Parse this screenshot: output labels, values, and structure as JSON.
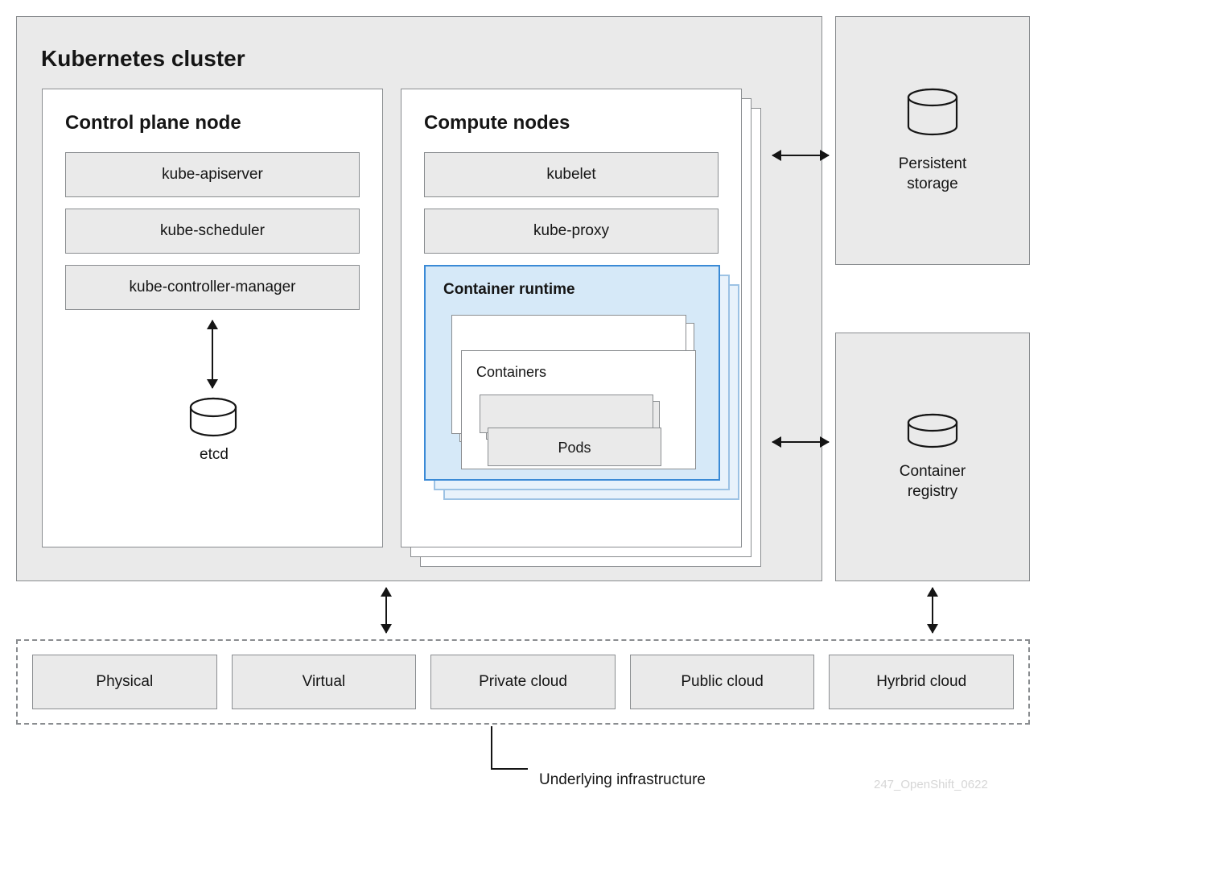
{
  "cluster": {
    "title": "Kubernetes cluster",
    "control_plane": {
      "title": "Control plane node",
      "components": [
        "kube-apiserver",
        "kube-scheduler",
        "kube-controller-manager"
      ],
      "etcd_label": "etcd"
    },
    "compute": {
      "title": "Compute nodes",
      "components": [
        "kubelet",
        "kube-proxy"
      ],
      "runtime": {
        "title": "Container runtime",
        "containers_label": "Containers",
        "pods_label": "Pods"
      }
    }
  },
  "storage": {
    "label": "Persistent\nstorage"
  },
  "registry": {
    "label": "Container\nregistry"
  },
  "infra": {
    "items": [
      "Physical",
      "Virtual",
      "Private cloud",
      "Public cloud",
      "Hyrbrid cloud"
    ],
    "caption": "Underlying infrastructure"
  },
  "watermark": "247_OpenShift_0622"
}
